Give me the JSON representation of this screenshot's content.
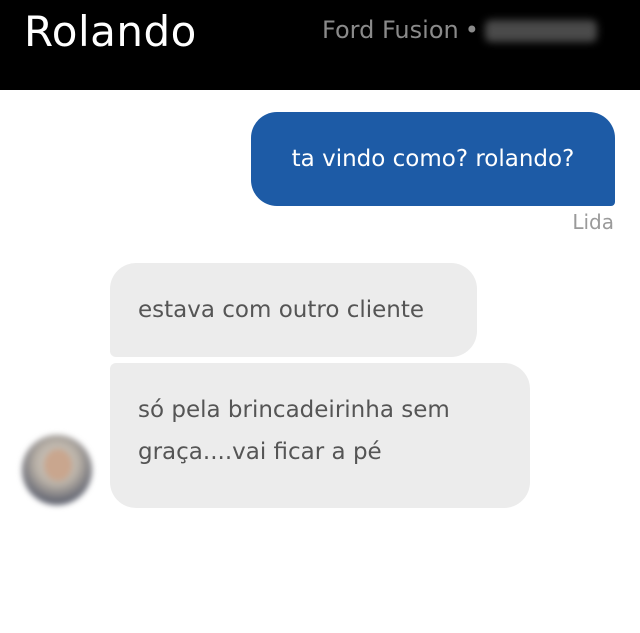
{
  "header": {
    "driver_name": "Rolando",
    "vehicle_model": "Ford Fusion",
    "separator": "•"
  },
  "messages": {
    "outgoing": [
      {
        "text": "ta vindo como? rolando?",
        "status": "Lida"
      }
    ],
    "incoming": [
      {
        "text": "estava com outro cliente"
      },
      {
        "line1": "só pela brincadeirinha sem",
        "line2": "graça....vai ficar a pé"
      }
    ]
  },
  "colors": {
    "header_bg": "#000000",
    "outgoing_bubble": "#1d5ba6",
    "incoming_bubble": "#ececec"
  },
  "icons": {
    "avatar": "driver-avatar-blurred"
  }
}
